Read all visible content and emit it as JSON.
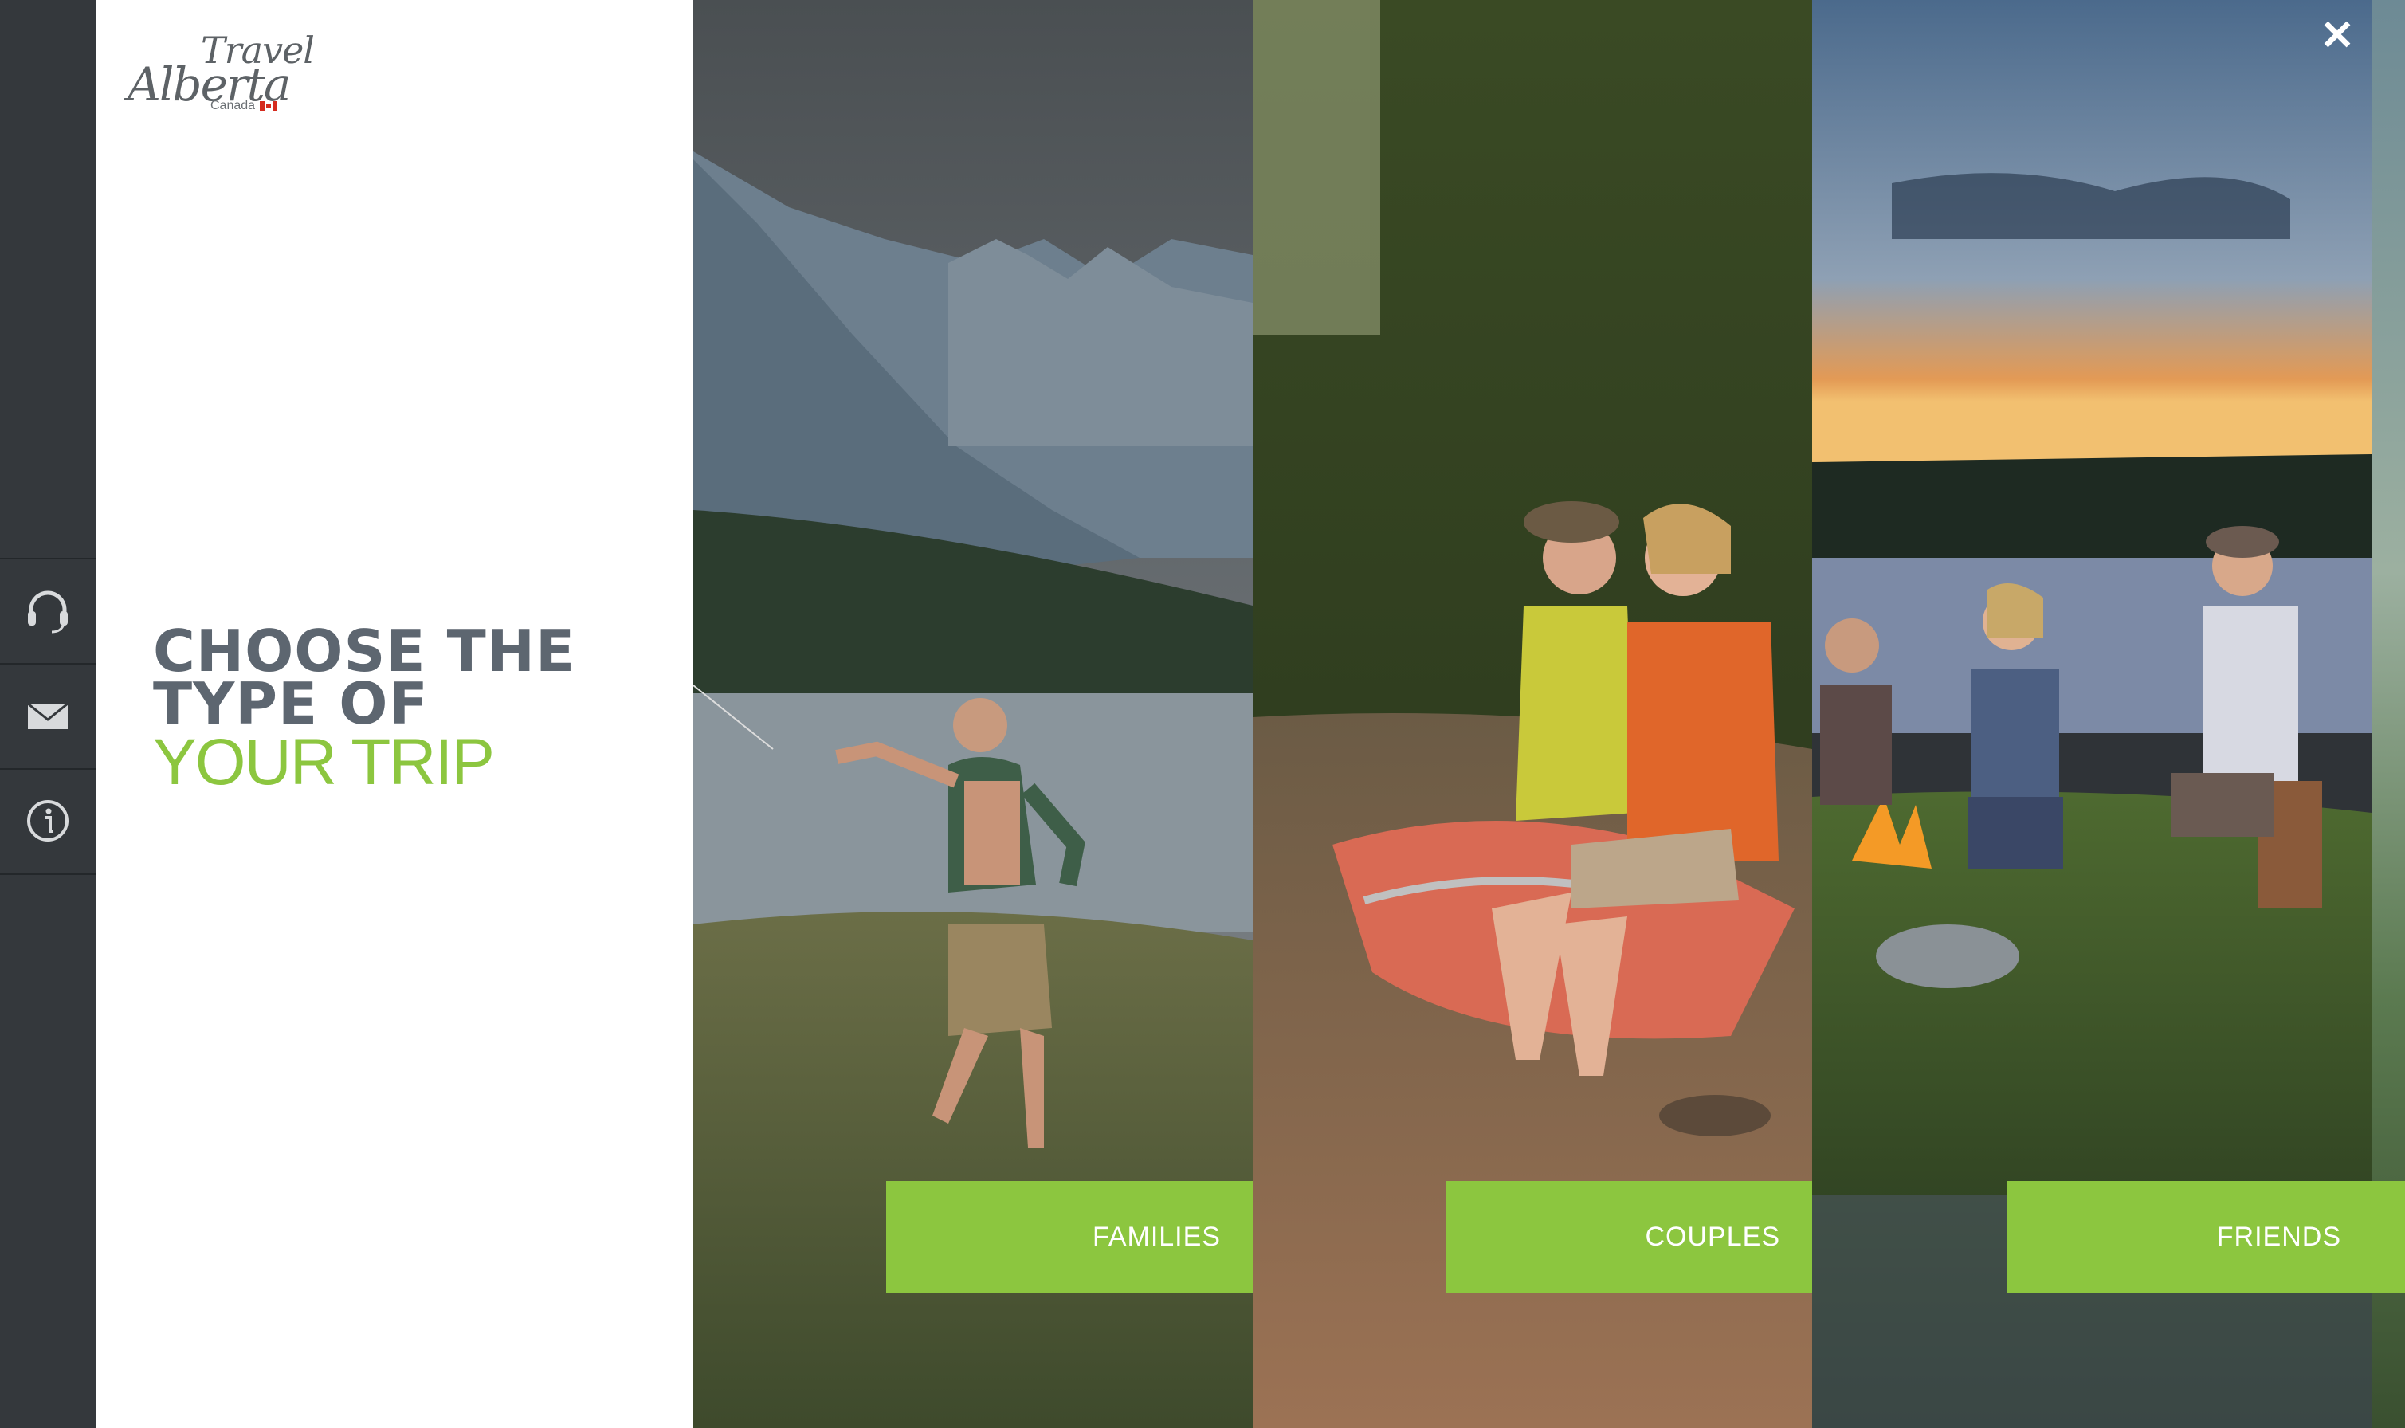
{
  "logo": {
    "line1": "Travel",
    "line2": "Alberta",
    "country": "Canada"
  },
  "sidebar": {
    "items": [
      {
        "icon": "headset-icon"
      },
      {
        "icon": "mail-icon"
      },
      {
        "icon": "info-icon"
      }
    ]
  },
  "headline": {
    "line1": "CHOOSE THE",
    "line2": "TYPE OF",
    "line3": "YOUR TRIP"
  },
  "options": [
    {
      "label": "FAMILIES"
    },
    {
      "label": "COUPLES"
    },
    {
      "label": "FRIENDS"
    }
  ],
  "close": {
    "label": "✕"
  },
  "colors": {
    "accent": "#8cc63f",
    "rail": "#34383c",
    "heading": "#5d6670"
  }
}
